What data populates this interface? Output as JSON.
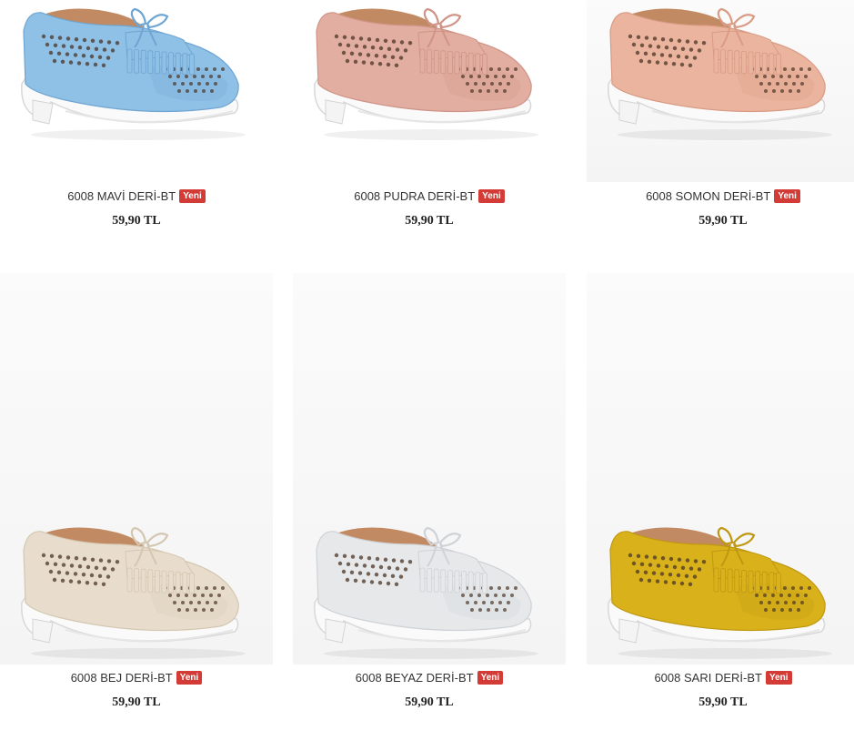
{
  "products": [
    {
      "name": "6008 MAVİ DERİ-BT",
      "badge": "Yeni",
      "price": "59,90 TL",
      "color": "#8fc0e6",
      "shade": "#6ea5d2",
      "inner": "#c28a62"
    },
    {
      "name": "6008 PUDRA DERİ-BT",
      "badge": "Yeni",
      "price": "59,90 TL",
      "color": "#e2aea1",
      "shade": "#cf9487",
      "inner": "#c28a62"
    },
    {
      "name": "6008 SOMON DERİ-BT",
      "badge": "Yeni",
      "price": "59,90 TL",
      "color": "#ebb49e",
      "shade": "#d99b84",
      "inner": "#c28a62"
    },
    {
      "name": "6008 BEJ DERİ-BT",
      "badge": "Yeni",
      "price": "59,90 TL",
      "color": "#e8ddcc",
      "shade": "#d4c7b2",
      "inner": "#c28a62"
    },
    {
      "name": "6008 BEYAZ DERİ-BT",
      "badge": "Yeni",
      "price": "59,90 TL",
      "color": "#e6e8ea",
      "shade": "#cfd2d6",
      "inner": "#c28a62"
    },
    {
      "name": "6008 SARI DERİ-BT",
      "badge": "Yeni",
      "price": "59,90 TL",
      "color": "#d9b21b",
      "shade": "#bf9812",
      "inner": "#c28a62"
    }
  ]
}
